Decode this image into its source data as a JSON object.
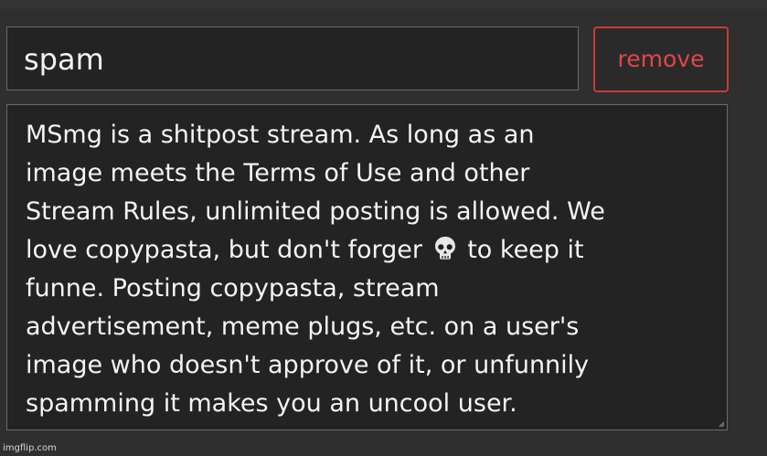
{
  "rule_editor": {
    "name_value": "spam",
    "remove_label": "remove",
    "description_lines": [
      "MSmg is a shitpost stream. As long as an",
      "image meets the Terms of Use and other",
      "Stream Rules, unlimited posting is allowed. We",
      "love copypasta, but don't forger",
      "to keep it",
      "funne. Posting copypasta, stream",
      "advertisement, meme plugs, etc. on a user's",
      "image who doesn't approve of it, or unfunnily",
      "spamming it makes you an uncool user."
    ],
    "emoji": "skull-icon"
  },
  "watermark": "imgflip.com",
  "colors": {
    "background": "#2f2f2f",
    "field": "#232323",
    "remove": "#e24646"
  }
}
